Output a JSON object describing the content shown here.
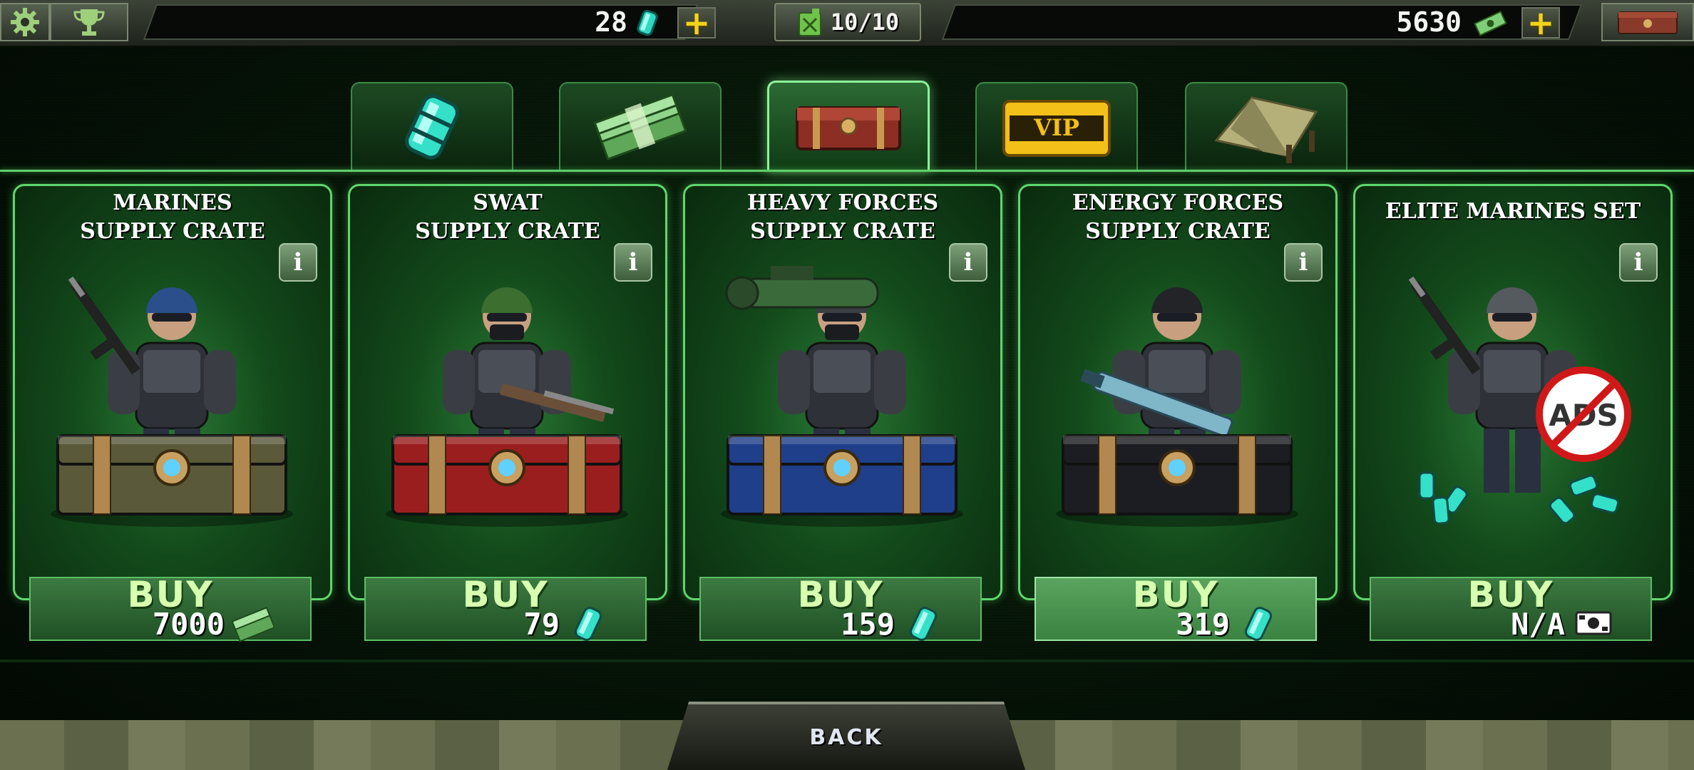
{
  "topbar": {
    "gems": "28",
    "fuel": "10/10",
    "cash": "5630",
    "icons": [
      "gear-icon",
      "trophy-icon",
      "gem-icon",
      "plus-icon",
      "fuel-can-icon",
      "cash-icon",
      "crate-icon"
    ]
  },
  "tabs": [
    {
      "name": "gems-tab",
      "icon": "gem-canister-icon",
      "active": false
    },
    {
      "name": "cash-tab",
      "icon": "cash-stack-icon",
      "active": false
    },
    {
      "name": "crates-tab",
      "icon": "crate-icon",
      "active": true
    },
    {
      "name": "vip-tab",
      "icon": "vip-card-icon",
      "label": "VIP",
      "active": false
    },
    {
      "name": "tent-tab",
      "icon": "tent-icon",
      "active": false
    }
  ],
  "cards": [
    {
      "title": "MARINES\nSUPPLY CRATE",
      "buy": "BUY",
      "price": "7000",
      "currency": "cash-icon",
      "crate_color": "#5a5a3a",
      "accent": "#1f4fa0"
    },
    {
      "title": "SWAT\nSUPPLY CRATE",
      "buy": "BUY",
      "price": "79",
      "currency": "gem-icon",
      "crate_color": "#9a1e1e",
      "accent": "#3b6e2f"
    },
    {
      "title": "HEAVY FORCES\nSUPPLY CRATE",
      "buy": "BUY",
      "price": "159",
      "currency": "gem-icon",
      "crate_color": "#1f3f8a",
      "accent": "#3a3f44"
    },
    {
      "title": "ENERGY FORCES\nSUPPLY CRATE",
      "buy": "BUY",
      "price": "319",
      "currency": "gem-icon",
      "crate_color": "#1b1d22",
      "accent": "#222"
    },
    {
      "title": "ELITE MARINES SET",
      "buy": "BUY",
      "price": "N/A",
      "currency": "ad-icon",
      "no_ads_label": "ADS",
      "crate_color": null,
      "accent": "#555"
    }
  ],
  "back_label": "BACK",
  "colors": {
    "accent_green": "#5fd66c",
    "gem": "#37e0c8",
    "cash": "#7fcf7a",
    "plus": "#f2d21c"
  }
}
